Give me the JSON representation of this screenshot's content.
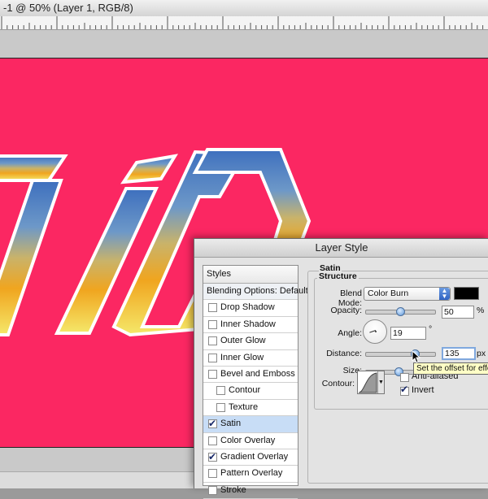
{
  "document": {
    "title": "-1 @ 50% (Layer 1, RGB/8)",
    "canvas_color": "#fb2762"
  },
  "dialog": {
    "title": "Layer Style",
    "styles_header": "Styles",
    "styles": [
      {
        "label": "Blending Options: Default",
        "checkbox": false,
        "checked": false,
        "indent": 0,
        "selected": false
      },
      {
        "label": "Drop Shadow",
        "checkbox": true,
        "checked": false,
        "indent": 0,
        "selected": false
      },
      {
        "label": "Inner Shadow",
        "checkbox": true,
        "checked": false,
        "indent": 0,
        "selected": false
      },
      {
        "label": "Outer Glow",
        "checkbox": true,
        "checked": false,
        "indent": 0,
        "selected": false
      },
      {
        "label": "Inner Glow",
        "checkbox": true,
        "checked": false,
        "indent": 0,
        "selected": false
      },
      {
        "label": "Bevel and Emboss",
        "checkbox": true,
        "checked": false,
        "indent": 0,
        "selected": false
      },
      {
        "label": "Contour",
        "checkbox": true,
        "checked": false,
        "indent": 1,
        "selected": false
      },
      {
        "label": "Texture",
        "checkbox": true,
        "checked": false,
        "indent": 1,
        "selected": false
      },
      {
        "label": "Satin",
        "checkbox": true,
        "checked": true,
        "indent": 0,
        "selected": true
      },
      {
        "label": "Color Overlay",
        "checkbox": true,
        "checked": false,
        "indent": 0,
        "selected": false
      },
      {
        "label": "Gradient Overlay",
        "checkbox": true,
        "checked": true,
        "indent": 0,
        "selected": false
      },
      {
        "label": "Pattern Overlay",
        "checkbox": true,
        "checked": false,
        "indent": 0,
        "selected": false
      },
      {
        "label": "Stroke",
        "checkbox": true,
        "checked": false,
        "indent": 0,
        "selected": false
      }
    ],
    "satin": {
      "title": "Satin",
      "structure_title": "Structure",
      "blend_mode_label": "Blend Mode:",
      "blend_mode_value": "Color Burn",
      "color": "#000000",
      "opacity_label": "Opacity:",
      "opacity_value": "50",
      "opacity_unit": "%",
      "opacity_fraction": 0.5,
      "angle_label": "Angle:",
      "angle_value": "19",
      "angle_unit": "°",
      "distance_label": "Distance:",
      "distance_value": "135",
      "distance_unit": "px",
      "distance_fraction": 0.74,
      "size_label": "Size:",
      "size_fraction": 0.47,
      "contour_label": "Contour:",
      "anti_aliased_label": "Anti-aliased",
      "anti_aliased_checked": false,
      "invert_label": "Invert",
      "invert_checked": true,
      "tooltip": "Set the offset for effect"
    }
  }
}
